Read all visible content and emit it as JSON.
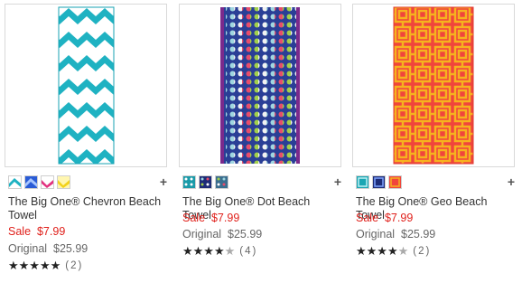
{
  "products": [
    {
      "name": "The Big One® Chevron Beach Towel",
      "sale_label": "Sale",
      "sale_price": "$7.99",
      "original_label": "Original",
      "original_price": "$25.99",
      "rating": 5,
      "stars_text": "★★★★★",
      "review_count": "(2)",
      "swatches": [
        "aqua-chevron",
        "blue-chevron",
        "pink-chevron",
        "yellow-chevron"
      ],
      "image": "chevron-towel-image",
      "colors": {
        "primary": "#1fb2c2",
        "secondary": "#ffffff"
      }
    },
    {
      "name": "The Big One® Dot Beach Towel",
      "sale_label": "Sale",
      "sale_price": "$7.99",
      "original_label": "Original",
      "original_price": "$25.99",
      "rating": 4.5,
      "stars_text": "★★★★",
      "review_count": "(4)",
      "swatches": [
        "teal-dot",
        "navy-dot",
        "multi-dot"
      ],
      "image": "dot-towel-image",
      "colors": {
        "primary": "#2a3f96",
        "secondary": "#7fc9d4"
      }
    },
    {
      "name": "The Big One® Geo Beach Towel",
      "sale_label": "Sale",
      "sale_price": "$7.99",
      "original_label": "Original",
      "original_price": "$25.99",
      "rating": 4.5,
      "stars_text": "★★★★",
      "review_count": "(2)",
      "swatches": [
        "teal-geo",
        "navy-geo",
        "orange-geo"
      ],
      "image": "geo-towel-image",
      "colors": {
        "primary": "#f0453c",
        "secondary": "#f6b21f"
      }
    }
  ],
  "add_label": "+",
  "colors": {
    "sale": "#e0201b",
    "text": "#333333",
    "border": "#d9d9d9"
  }
}
